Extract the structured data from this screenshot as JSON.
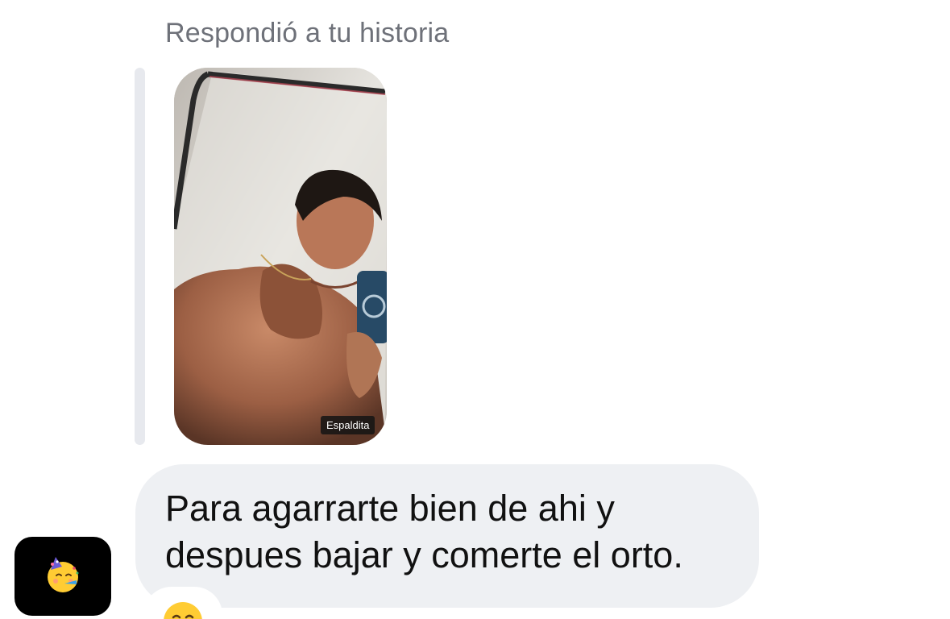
{
  "conversation": {
    "reply_caption": "Respondió a tu historia",
    "story": {
      "sticker_text": "Espaldita"
    },
    "message": {
      "text": "Para agarrarte bien de ahi y\ndespues bajar y comerte el orto."
    },
    "reaction": {
      "icon": "smiling-face-emoji-icon"
    },
    "sender": {
      "avatar_icon": "partying-face-emoji-icon"
    }
  },
  "colors": {
    "caption_gray": "#6e7179",
    "bubble_background": "#eef0f3",
    "quote_bar": "#e7e9ee",
    "avatar_background": "#000000",
    "text": "#111111"
  }
}
